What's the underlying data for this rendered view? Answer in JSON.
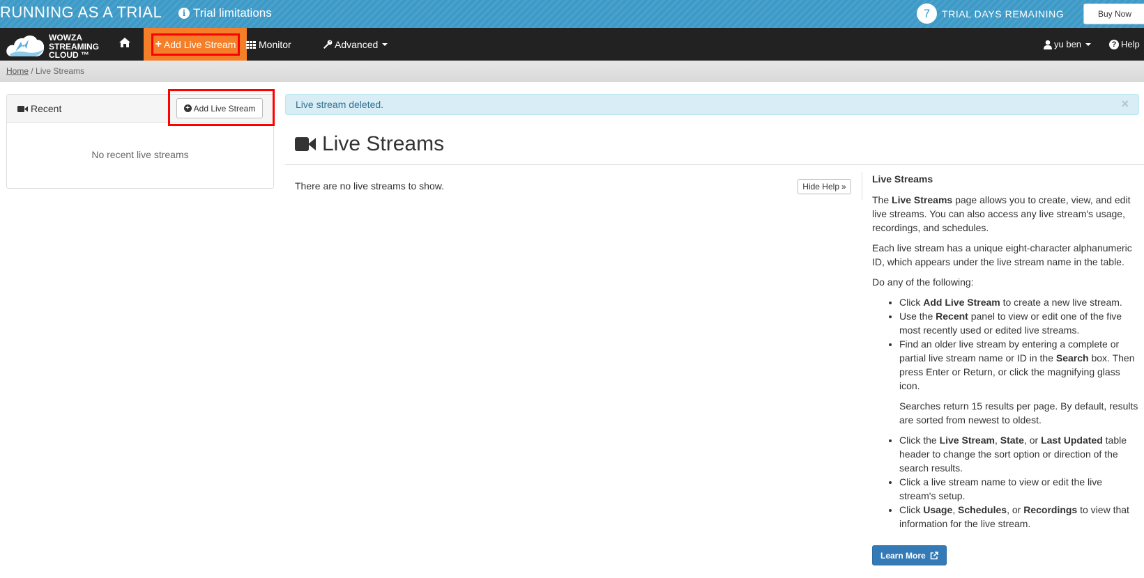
{
  "trial_banner": {
    "title": "RUNNING AS A TRIAL",
    "limitations_label": "Trial limitations",
    "days_remaining": "7",
    "days_remaining_label": "TRIAL DAYS REMAINING",
    "buy_now_label": "Buy Now"
  },
  "navbar": {
    "logo_line1": "WOWZA",
    "logo_line2": "STREAMING",
    "logo_line3": "CLOUD ™",
    "add_live_stream_label": "Add Live Stream",
    "monitor_label": "Monitor",
    "advanced_label": "Advanced",
    "user_label": "yu ben",
    "help_label": "Help"
  },
  "breadcrumb": {
    "home_label": "Home",
    "separator": " / ",
    "current_label": "Live Streams"
  },
  "recent_panel": {
    "title": "Recent",
    "add_button_label": "Add Live Stream",
    "empty_text": "No recent live streams"
  },
  "alert": {
    "message": "Live stream deleted.",
    "close_symbol": "×"
  },
  "main": {
    "title": "Live Streams",
    "empty_text": "There are no live streams to show.",
    "hide_help_label": "Hide Help"
  },
  "help": {
    "heading": "Live Streams",
    "p1_a": "The ",
    "p1_b": "Live Streams",
    "p1_c": " page allows you to create, view, and edit live streams. You can also access any live stream's usage, recordings, and schedules.",
    "p2": "Each live stream has a unique eight-character alphanumeric ID, which appears under the live stream name in the table.",
    "p3": "Do any of the following:",
    "li1_a": "Click ",
    "li1_b": "Add Live Stream",
    "li1_c": " to create a new live stream.",
    "li2_a": "Use the ",
    "li2_b": "Recent",
    "li2_c": " panel to view or edit one of the five most recently used or edited live streams.",
    "li3_a": "Find an older live stream by entering a complete or partial live stream name or ID in the ",
    "li3_b": "Search",
    "li3_c": " box. Then press Enter or Return, or click the magnifying glass icon.",
    "sub": "Searches return 15 results per page. By default, results are sorted from newest to oldest.",
    "li4_a": "Click the ",
    "li4_b": "Live Stream",
    "li4_c": ", ",
    "li4_d": "State",
    "li4_e": ", or ",
    "li4_f": "Last Updated",
    "li4_g": " table header to change the sort option or direction of the search results.",
    "li5": "Click a live stream name to view or edit the live stream's setup.",
    "li6_a": "Click ",
    "li6_b": "Usage",
    "li6_c": ", ",
    "li6_d": "Schedules",
    "li6_e": ", or ",
    "li6_f": "Recordings",
    "li6_g": " to view that information for the live stream.",
    "learn_more_label": "Learn More"
  },
  "colors": {
    "trial_bar": "#3d9ac7",
    "navbar": "#222222",
    "nav_active": "#f47f28",
    "highlight_box": "#ff0000",
    "alert_bg": "#d9edf7",
    "primary_button": "#337ab7"
  }
}
